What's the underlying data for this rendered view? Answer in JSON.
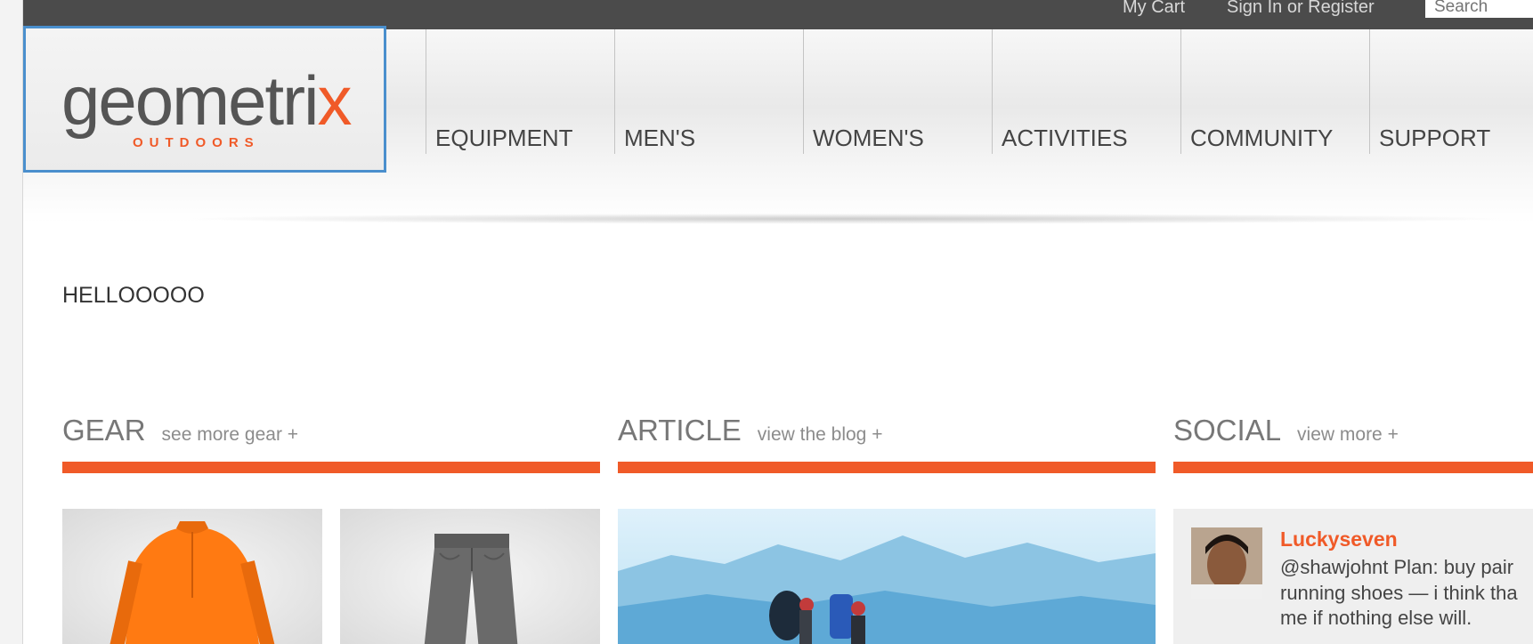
{
  "topbar": {
    "cart": "My Cart",
    "signin": "Sign In or Register",
    "search_placeholder": "Search"
  },
  "logo": {
    "word": "geometri",
    "word_end": "x",
    "sub": "OUTDOORS"
  },
  "nav": [
    "EQUIPMENT",
    "MEN'S",
    "WOMEN'S",
    "ACTIVITIES",
    "COMMUNITY",
    "SUPPORT"
  ],
  "main": {
    "hello": "HELLOOOOO"
  },
  "sections": {
    "gear": {
      "title": "GEAR",
      "more": "see more gear +"
    },
    "article": {
      "title": "ARTICLE",
      "more": "view the blog +"
    },
    "social": {
      "title": "SOCIAL",
      "more": "view more +"
    }
  },
  "social_post": {
    "user": "Luckyseven",
    "text": "@shawjohnt Plan: buy pair\nrunning shoes — i think tha\nme if nothing else will."
  },
  "colors": {
    "accent": "#f05a28",
    "topbar": "#4b4b4b",
    "logo_border": "#4a8fcd"
  }
}
